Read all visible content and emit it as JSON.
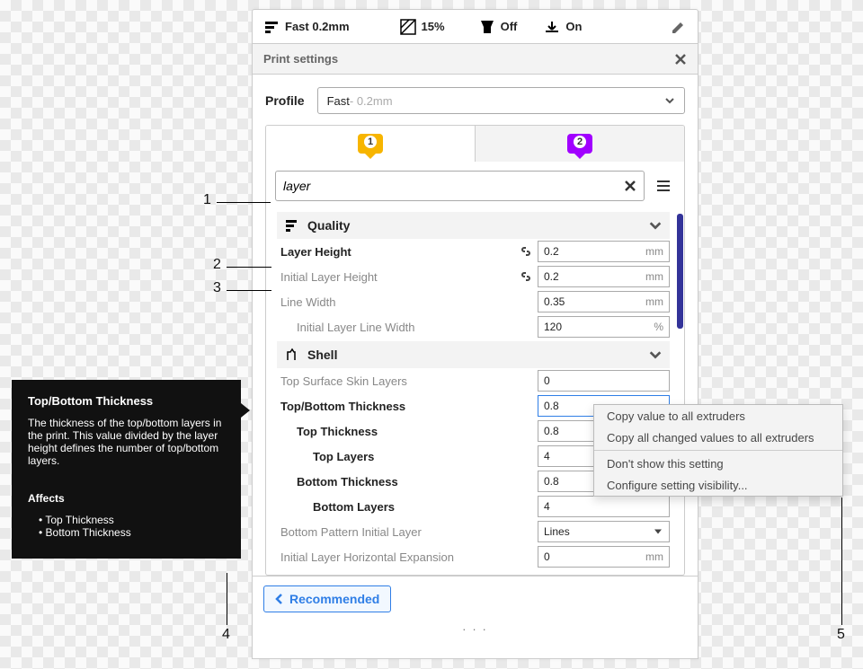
{
  "strip": {
    "profile": "Fast 0.2mm",
    "infill": "15%",
    "support": "Off",
    "adhesion": "On"
  },
  "panel_title": "Print settings",
  "profile_label": "Profile",
  "profile_value": "Fast",
  "profile_suffix": " - 0.2mm",
  "extruder_tabs": {
    "one": "1",
    "two": "2"
  },
  "search_value": "layer",
  "sections": {
    "quality": {
      "title": "Quality",
      "layer_height": {
        "label": "Layer Height",
        "value": "0.2",
        "unit": "mm"
      },
      "initial_layer_height": {
        "label": "Initial Layer Height",
        "value": "0.2",
        "unit": "mm"
      },
      "line_width": {
        "label": "Line Width",
        "value": "0.35",
        "unit": "mm"
      },
      "initial_line_width": {
        "label": "Initial Layer Line Width",
        "value": "120",
        "unit": "%"
      }
    },
    "shell": {
      "title": "Shell",
      "top_surface_skin": {
        "label": "Top Surface Skin Layers",
        "value": "0"
      },
      "top_bottom_thickness": {
        "label": "Top/Bottom Thickness",
        "value": "0.8"
      },
      "top_thickness": {
        "label": "Top Thickness",
        "value": "0.8"
      },
      "top_layers": {
        "label": "Top Layers",
        "value": "4"
      },
      "bottom_thickness": {
        "label": "Bottom Thickness",
        "value": "0.8"
      },
      "bottom_layers": {
        "label": "Bottom Layers",
        "value": "4"
      },
      "bottom_pattern_initial": {
        "label": "Bottom Pattern Initial Layer",
        "value": "Lines"
      },
      "initial_horiz_exp": {
        "label": "Initial Layer Horizontal Expansion",
        "value": "0",
        "unit": "mm"
      }
    }
  },
  "recommended": "Recommended",
  "tooltip": {
    "title": "Top/Bottom Thickness",
    "body": "The thickness of the top/bottom layers in the print. This value divided by the layer height defines the number of top/bottom layers.",
    "affects_h": "Affects",
    "affects": {
      "a": "Top Thickness",
      "b": "Bottom Thickness"
    }
  },
  "ctx": {
    "copy_one": "Copy value to all extruders",
    "copy_all": "Copy all changed values to all extruders",
    "hide": "Don't show this setting",
    "config": "Configure setting visibility..."
  },
  "callouts": {
    "n1": "1",
    "n2": "2",
    "n3": "3",
    "n4": "4",
    "n5": "5"
  }
}
